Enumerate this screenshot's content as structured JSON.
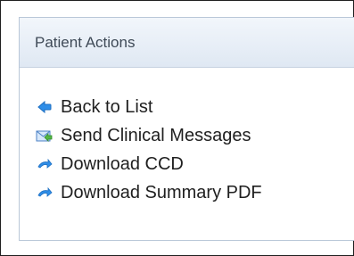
{
  "panel": {
    "title": "Patient Actions",
    "items": [
      {
        "label": "Back to List",
        "icon": "back-arrow-icon"
      },
      {
        "label": "Send Clinical Messages",
        "icon": "message-envelope-icon"
      },
      {
        "label": "Download CCD",
        "icon": "download-arc-icon"
      },
      {
        "label": "Download Summary PDF",
        "icon": "download-arc-icon"
      }
    ]
  },
  "colors": {
    "header_top": "#f2f6fb",
    "header_bottom": "#dfe8f3",
    "border": "#b9c7d8",
    "text": "#1f1f1f",
    "icon_blue": "#2f8ee8",
    "icon_green": "#53b743"
  }
}
